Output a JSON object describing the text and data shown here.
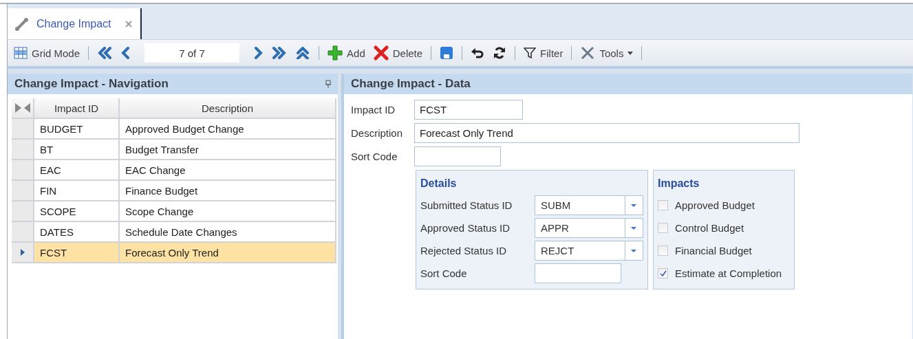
{
  "tabs": [
    {
      "label": "Change Impact",
      "selected": true
    }
  ],
  "toolbar": {
    "grid_mode": "Grid Mode",
    "record": "7 of 7",
    "add": "Add",
    "delete": "Delete",
    "filter": "Filter",
    "tools": "Tools"
  },
  "navigation": {
    "title": "Change Impact - Navigation",
    "columns": [
      "Impact ID",
      "Description"
    ],
    "rows": [
      {
        "id": "BUDGET",
        "description": "Approved Budget Change",
        "selected": false
      },
      {
        "id": "BT",
        "description": "Budget Transfer",
        "selected": false
      },
      {
        "id": "EAC",
        "description": "EAC Change",
        "selected": false
      },
      {
        "id": "FIN",
        "description": "Finance Budget",
        "selected": false
      },
      {
        "id": "SCOPE",
        "description": "Scope Change",
        "selected": false
      },
      {
        "id": "DATES",
        "description": "Schedule Date Changes",
        "selected": false
      },
      {
        "id": "FCST",
        "description": "Forecast Only Trend",
        "selected": true
      }
    ]
  },
  "data": {
    "title": "Change Impact - Data",
    "fields": [
      {
        "label": "Impact ID",
        "value": "FCST"
      },
      {
        "label": "Description",
        "value": "Forecast Only Trend"
      },
      {
        "label": "Sort Code"
      }
    ],
    "details": {
      "title": "Details",
      "fields": [
        {
          "label": "Submitted Status ID",
          "value": "SUBM",
          "kind": "dropdown"
        },
        {
          "label": "Approved Status ID",
          "value": "APPR",
          "kind": "dropdown"
        },
        {
          "label": "Rejected Status ID",
          "value": "REJCT",
          "kind": "dropdown"
        },
        {
          "label": "Sort Code",
          "kind": "text"
        }
      ]
    },
    "impacts": {
      "title": "Impacts",
      "items": [
        {
          "label": "Approved Budget",
          "checked": false
        },
        {
          "label": "Control Budget",
          "checked": false
        },
        {
          "label": "Financial Budget",
          "checked": false
        },
        {
          "label": "Estimate at Completion",
          "checked": true
        }
      ]
    }
  }
}
